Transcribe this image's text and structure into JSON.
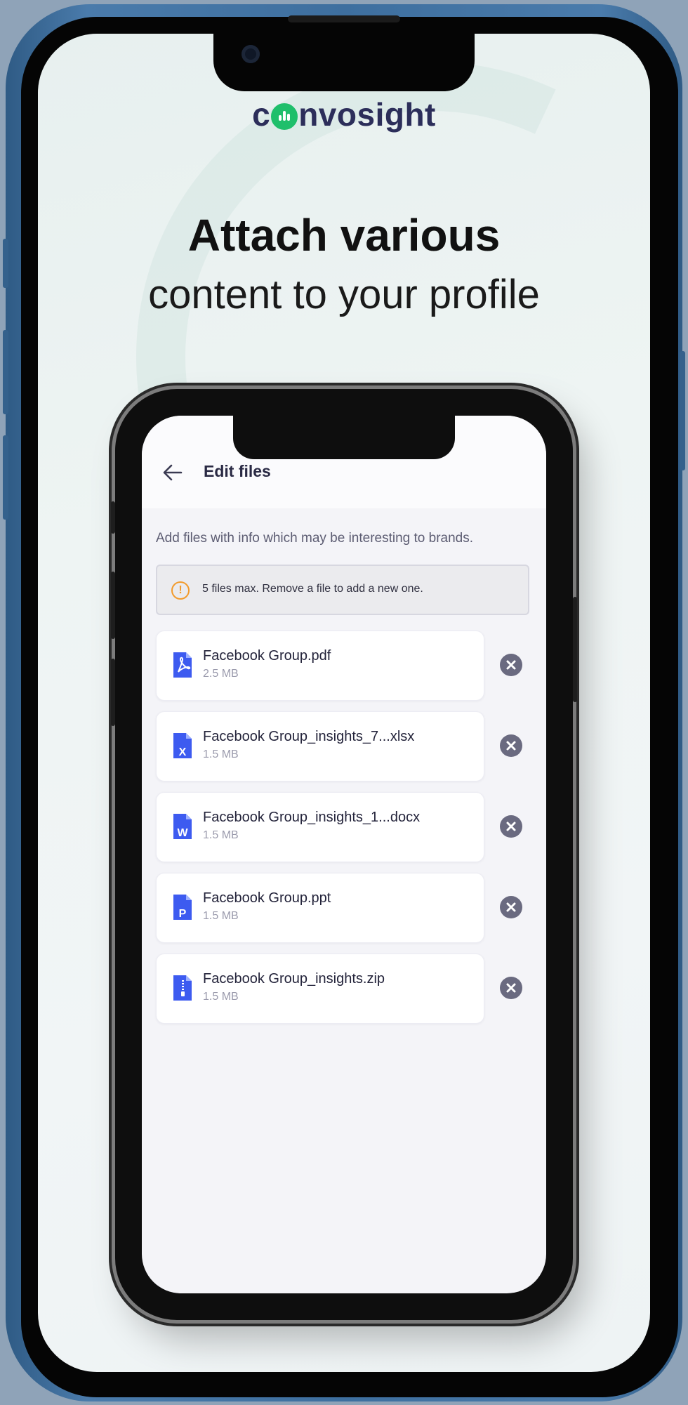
{
  "brand": {
    "logo_prefix": "c",
    "logo_suffix": "nvosight",
    "accent": "#1fbf6b",
    "text_color": "#2c2e5a"
  },
  "hero": {
    "headline": "Attach various",
    "subheadline": "content to your profile"
  },
  "app": {
    "header": {
      "title": "Edit files",
      "back_icon": "arrow-left-icon"
    },
    "intro_text": "Add files with info which may be interesting to brands.",
    "warning": {
      "icon": "!",
      "text": "5 files max. Remove a file to add a new one.",
      "color": "#f29b2c"
    },
    "files": [
      {
        "name": "Facebook Group.pdf",
        "size": "2.5 MB",
        "type": "pdf",
        "badge": ""
      },
      {
        "name": "Facebook Group_insights_7...xlsx",
        "size": "1.5 MB",
        "type": "xlsx",
        "badge": "X"
      },
      {
        "name": "Facebook Group_insights_1...docx",
        "size": "1.5 MB",
        "type": "docx",
        "badge": "W"
      },
      {
        "name": "Facebook Group.ppt",
        "size": "1.5 MB",
        "type": "ppt",
        "badge": "P"
      },
      {
        "name": "Facebook Group_insights.zip",
        "size": "1.5 MB",
        "type": "zip",
        "badge": ""
      }
    ],
    "file_icon_color": "#3d5bf0",
    "remove_icon": "close-circle-icon"
  }
}
